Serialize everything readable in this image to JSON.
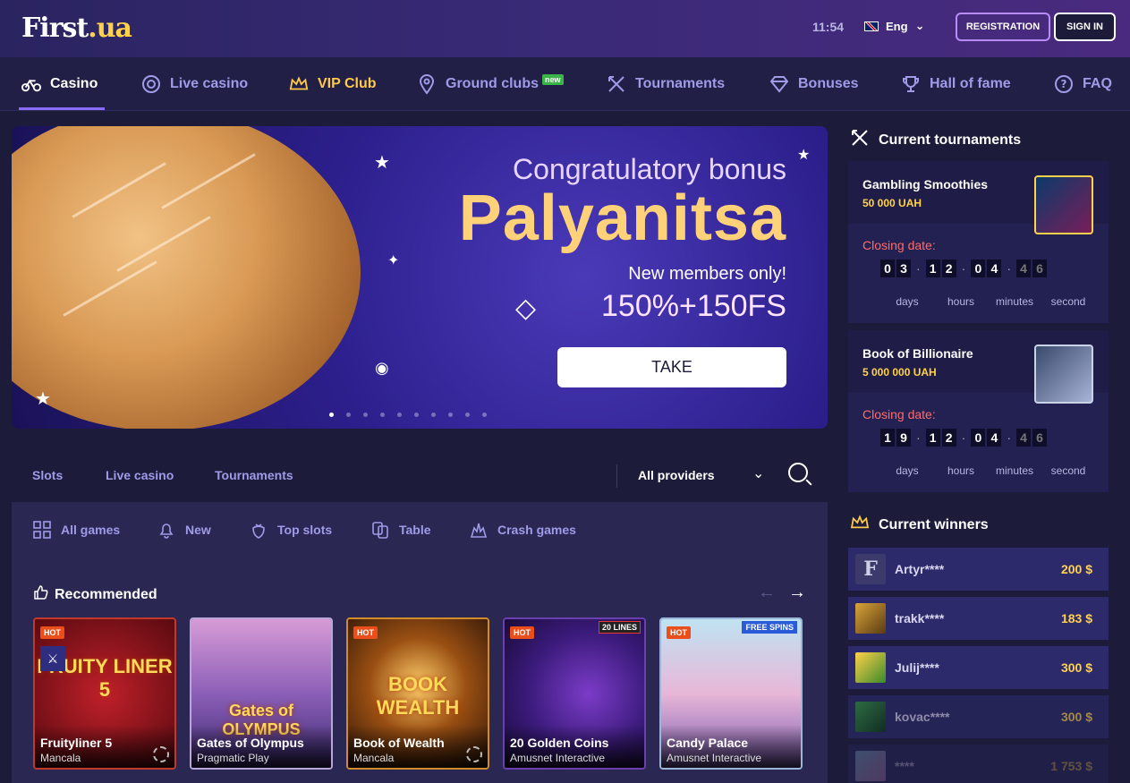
{
  "header": {
    "logo_main": "First",
    "logo_suffix": ".ua",
    "time": "11:54",
    "language": "Eng",
    "registration_label": "REGISTRATION",
    "signin_label": "SIGN IN"
  },
  "nav": {
    "items": [
      {
        "label": "Casino",
        "icon": "bicycle-icon"
      },
      {
        "label": "Live casino",
        "icon": "roulette-icon"
      },
      {
        "label": "VIP Club",
        "icon": "crown-icon"
      },
      {
        "label": "Ground clubs",
        "icon": "map-pin-icon",
        "badge": "new"
      },
      {
        "label": "Tournaments",
        "icon": "swords-icon"
      },
      {
        "label": "Bonuses",
        "icon": "diamond-icon"
      },
      {
        "label": "Hall of fame",
        "icon": "trophy-icon"
      },
      {
        "label": "FAQ",
        "icon": "question-icon"
      }
    ]
  },
  "banner": {
    "subtitle": "Congratulatory bonus",
    "title": "Palyanitsa",
    "note": "New members only!",
    "offer": "150%+150FS",
    "cta": "TAKE"
  },
  "game_tabs": {
    "tabs": [
      "Slots",
      "Live casino",
      "Tournaments"
    ],
    "provider_select": "All providers"
  },
  "categories": [
    {
      "label": "All games",
      "icon": "grid-icon"
    },
    {
      "label": "New",
      "icon": "bell-icon"
    },
    {
      "label": "Top slots",
      "icon": "strawberry-icon"
    },
    {
      "label": "Table",
      "icon": "cards-icon"
    },
    {
      "label": "Crash games",
      "icon": "explosion-icon"
    }
  ],
  "recommended": {
    "title": "Recommended",
    "games": [
      {
        "name": "Fruityliner 5",
        "provider": "Mancala",
        "badge": "HOT",
        "art": "FRUITY LINER 5"
      },
      {
        "name": "Gates of Olympus",
        "provider": "Pragmatic Play",
        "badge": "",
        "art": "Gates of OLYMPUS"
      },
      {
        "name": "Book of Wealth",
        "provider": "Mancala",
        "badge": "HOT",
        "art": "BOOK WEALTH"
      },
      {
        "name": "20 Golden Coins",
        "provider": "Amusnet Interactive",
        "badge": "HOT",
        "art": "20 LINES"
      },
      {
        "name": "Candy Palace",
        "provider": "Amusnet Interactive",
        "badge": "HOT",
        "art": "FREE SPINS"
      }
    ]
  },
  "tournaments": {
    "title": "Current tournaments",
    "closing_label": "Closing date:",
    "units": [
      "days",
      "hours",
      "minutes",
      "second"
    ],
    "items": [
      {
        "name": "Gambling Smoothies",
        "prize": "50 000 UAH",
        "digits": [
          "0",
          "3",
          "1",
          "2",
          "0",
          "4",
          "4",
          "6"
        ]
      },
      {
        "name": "Book of Billionaire",
        "prize": "5 000 000 UAH",
        "digits": [
          "1",
          "9",
          "1",
          "2",
          "0",
          "4",
          "4",
          "6"
        ]
      }
    ]
  },
  "winners": {
    "title": "Current winners",
    "items": [
      {
        "name": "Artyr****",
        "amount": "200 $"
      },
      {
        "name": "trakk****",
        "amount": "183 $"
      },
      {
        "name": "Julij****",
        "amount": "300 $"
      },
      {
        "name": "kovac****",
        "amount": "300 $"
      },
      {
        "name": "****",
        "amount": "1 753 $"
      }
    ]
  },
  "colors": {
    "accent": "#8a6bff",
    "gold": "#ffd24a",
    "nav_text": "#9f9be8",
    "hot": "#e94e1b"
  }
}
